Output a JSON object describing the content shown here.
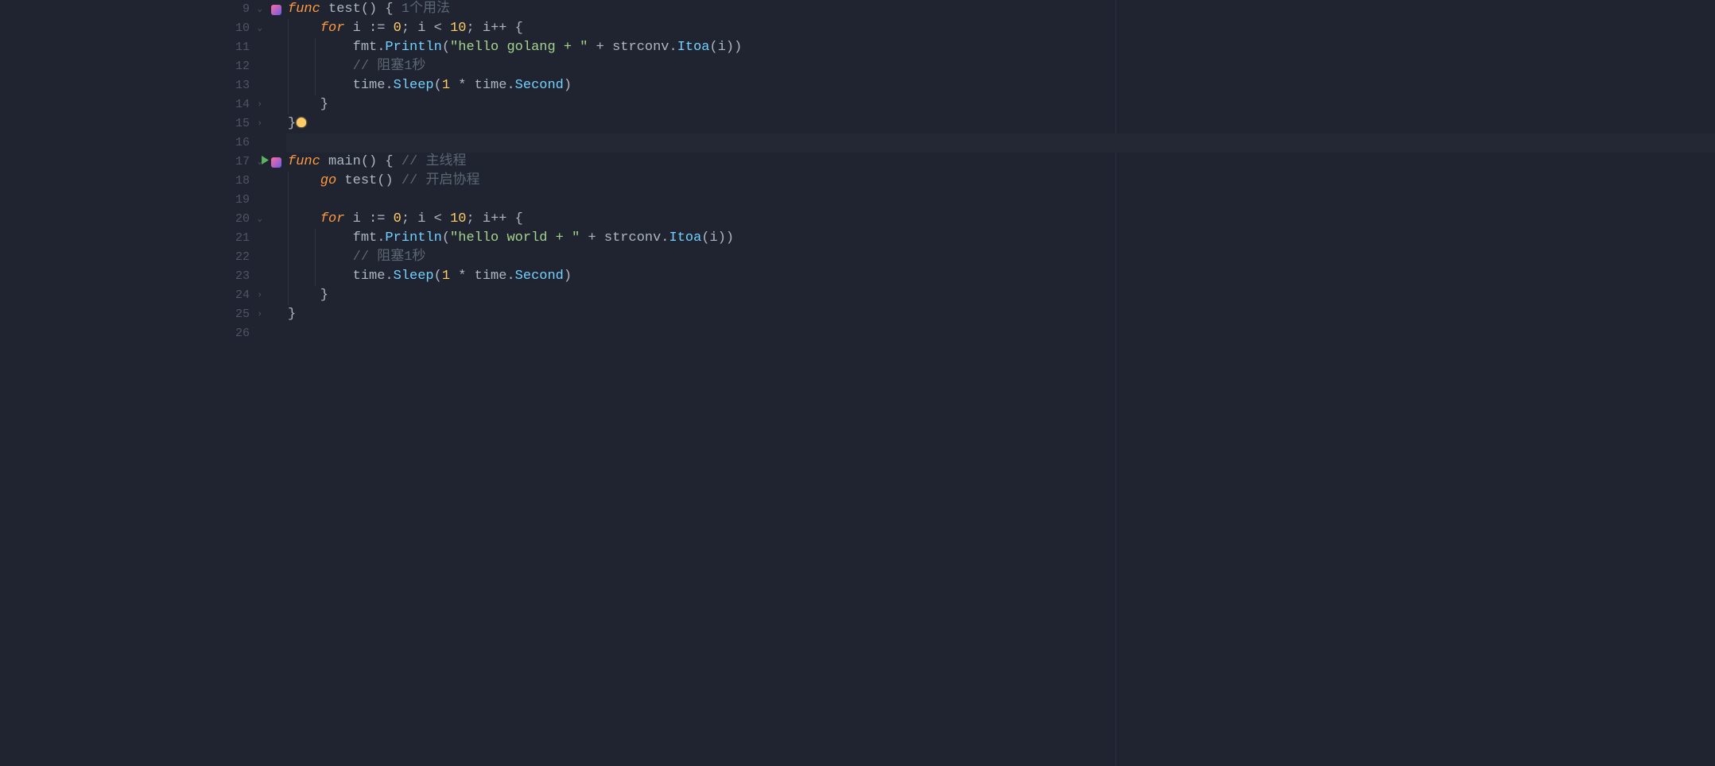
{
  "lines": [
    {
      "num": "9",
      "icons": {
        "struct": true
      },
      "fold": "open",
      "tokens": [
        {
          "t": "func ",
          "c": "kw"
        },
        {
          "t": "test",
          "c": "fn-name"
        },
        {
          "t": "() { ",
          "c": "punct"
        },
        {
          "t": "1个用法",
          "c": "comment"
        }
      ]
    },
    {
      "num": "10",
      "fold": "open",
      "indent": 1,
      "tokens": [
        {
          "t": "    ",
          "c": ""
        },
        {
          "t": "for ",
          "c": "kw2"
        },
        {
          "t": "i := ",
          "c": "ident"
        },
        {
          "t": "0",
          "c": "num"
        },
        {
          "t": "; i < ",
          "c": "ident"
        },
        {
          "t": "10",
          "c": "num"
        },
        {
          "t": "; i++ {",
          "c": "ident"
        }
      ]
    },
    {
      "num": "11",
      "indent": 2,
      "tokens": [
        {
          "t": "        fmt.",
          "c": "pkg"
        },
        {
          "t": "Println",
          "c": "call"
        },
        {
          "t": "(",
          "c": "punct"
        },
        {
          "t": "\"hello golang + \"",
          "c": "str"
        },
        {
          "t": " + strconv.",
          "c": "pkg"
        },
        {
          "t": "Itoa",
          "c": "call"
        },
        {
          "t": "(i))",
          "c": "punct"
        }
      ]
    },
    {
      "num": "12",
      "indent": 2,
      "tokens": [
        {
          "t": "        ",
          "c": ""
        },
        {
          "t": "// 阻塞1秒",
          "c": "comment"
        }
      ]
    },
    {
      "num": "13",
      "indent": 2,
      "tokens": [
        {
          "t": "        time.",
          "c": "pkg"
        },
        {
          "t": "Sleep",
          "c": "call"
        },
        {
          "t": "(",
          "c": "punct"
        },
        {
          "t": "1",
          "c": "num"
        },
        {
          "t": " * time.",
          "c": "pkg"
        },
        {
          "t": "Second",
          "c": "call"
        },
        {
          "t": ")",
          "c": "punct"
        }
      ]
    },
    {
      "num": "14",
      "fold": "close",
      "indent": 1,
      "tokens": [
        {
          "t": "    }",
          "c": "punct"
        }
      ]
    },
    {
      "num": "15",
      "fold": "close",
      "bulb": true,
      "tokens": [
        {
          "t": "}",
          "c": "punct"
        }
      ]
    },
    {
      "num": "16",
      "highlight": true,
      "tokens": []
    },
    {
      "num": "17",
      "icons": {
        "run": true,
        "struct": true
      },
      "fold": "open",
      "tokens": [
        {
          "t": "func ",
          "c": "kw"
        },
        {
          "t": "main",
          "c": "fn-name"
        },
        {
          "t": "() { ",
          "c": "punct"
        },
        {
          "t": "// 主线程",
          "c": "comment"
        }
      ]
    },
    {
      "num": "18",
      "indent": 1,
      "tokens": [
        {
          "t": "    ",
          "c": ""
        },
        {
          "t": "go ",
          "c": "kw2"
        },
        {
          "t": "test() ",
          "c": "ident"
        },
        {
          "t": "// 开启协程",
          "c": "comment"
        }
      ]
    },
    {
      "num": "19",
      "indent": 1,
      "tokens": []
    },
    {
      "num": "20",
      "fold": "open",
      "indent": 1,
      "tokens": [
        {
          "t": "    ",
          "c": ""
        },
        {
          "t": "for ",
          "c": "kw2"
        },
        {
          "t": "i := ",
          "c": "ident"
        },
        {
          "t": "0",
          "c": "num"
        },
        {
          "t": "; i < ",
          "c": "ident"
        },
        {
          "t": "10",
          "c": "num"
        },
        {
          "t": "; i++ {",
          "c": "ident"
        }
      ]
    },
    {
      "num": "21",
      "indent": 2,
      "tokens": [
        {
          "t": "        fmt.",
          "c": "pkg"
        },
        {
          "t": "Println",
          "c": "call"
        },
        {
          "t": "(",
          "c": "punct"
        },
        {
          "t": "\"hello world + \"",
          "c": "str"
        },
        {
          "t": " + strconv.",
          "c": "pkg"
        },
        {
          "t": "Itoa",
          "c": "call"
        },
        {
          "t": "(i))",
          "c": "punct"
        }
      ]
    },
    {
      "num": "22",
      "indent": 2,
      "tokens": [
        {
          "t": "        ",
          "c": ""
        },
        {
          "t": "// 阻塞1秒",
          "c": "comment"
        }
      ]
    },
    {
      "num": "23",
      "indent": 2,
      "tokens": [
        {
          "t": "        time.",
          "c": "pkg"
        },
        {
          "t": "Sleep",
          "c": "call"
        },
        {
          "t": "(",
          "c": "punct"
        },
        {
          "t": "1",
          "c": "num"
        },
        {
          "t": " * time.",
          "c": "pkg"
        },
        {
          "t": "Second",
          "c": "call"
        },
        {
          "t": ")",
          "c": "punct"
        }
      ]
    },
    {
      "num": "24",
      "fold": "close",
      "indent": 1,
      "tokens": [
        {
          "t": "    }",
          "c": "punct"
        }
      ]
    },
    {
      "num": "25",
      "fold": "close",
      "tokens": [
        {
          "t": "}",
          "c": "punct"
        }
      ]
    },
    {
      "num": "26",
      "tokens": []
    }
  ]
}
